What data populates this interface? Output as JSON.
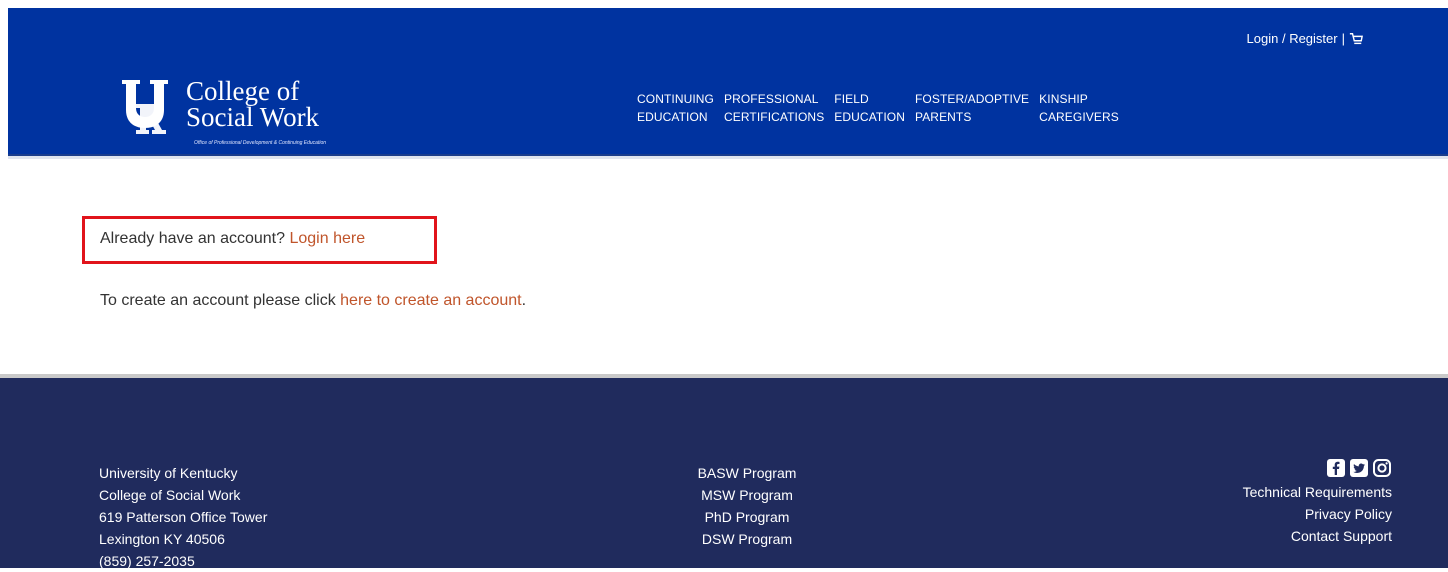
{
  "header": {
    "login_register": "Login / Register",
    "separator": "|",
    "logo": {
      "line1": "College of",
      "line2": "Social Work",
      "subtitle": "Office of Professional Development & Continuing Education"
    },
    "nav": [
      {
        "line1": "CONTINUING",
        "line2": "EDUCATION"
      },
      {
        "line1": "PROFESSIONAL",
        "line2": "CERTIFICATIONS"
      },
      {
        "line1": "FIELD",
        "line2": "EDUCATION"
      },
      {
        "line1": "FOSTER/ADOPTIVE",
        "line2": "PARENTS"
      },
      {
        "line1": "KINSHIP",
        "line2": "CAREGIVERS"
      }
    ]
  },
  "main": {
    "login_prompt": "Already have an account? ",
    "login_link": "Login here",
    "create_prompt": "To create an account please click ",
    "create_link": "here to create an account",
    "create_suffix": "."
  },
  "footer": {
    "address": [
      "University of Kentucky",
      "College of Social Work",
      "619 Patterson Office Tower",
      "Lexington KY 40506",
      "(859) 257-2035"
    ],
    "programs": [
      "BASW Program",
      "MSW Program",
      "PhD Program",
      "DSW Program"
    ],
    "links": [
      "Technical Requirements",
      "Privacy Policy",
      "Contact Support"
    ]
  },
  "colors": {
    "header_bg": "#0033a0",
    "footer_bg": "#202b5d",
    "link": "#c0552b",
    "highlight": "#e1141b"
  },
  "icons": [
    "cart-icon",
    "uk-logo-icon",
    "facebook-icon",
    "twitter-icon",
    "instagram-icon"
  ]
}
